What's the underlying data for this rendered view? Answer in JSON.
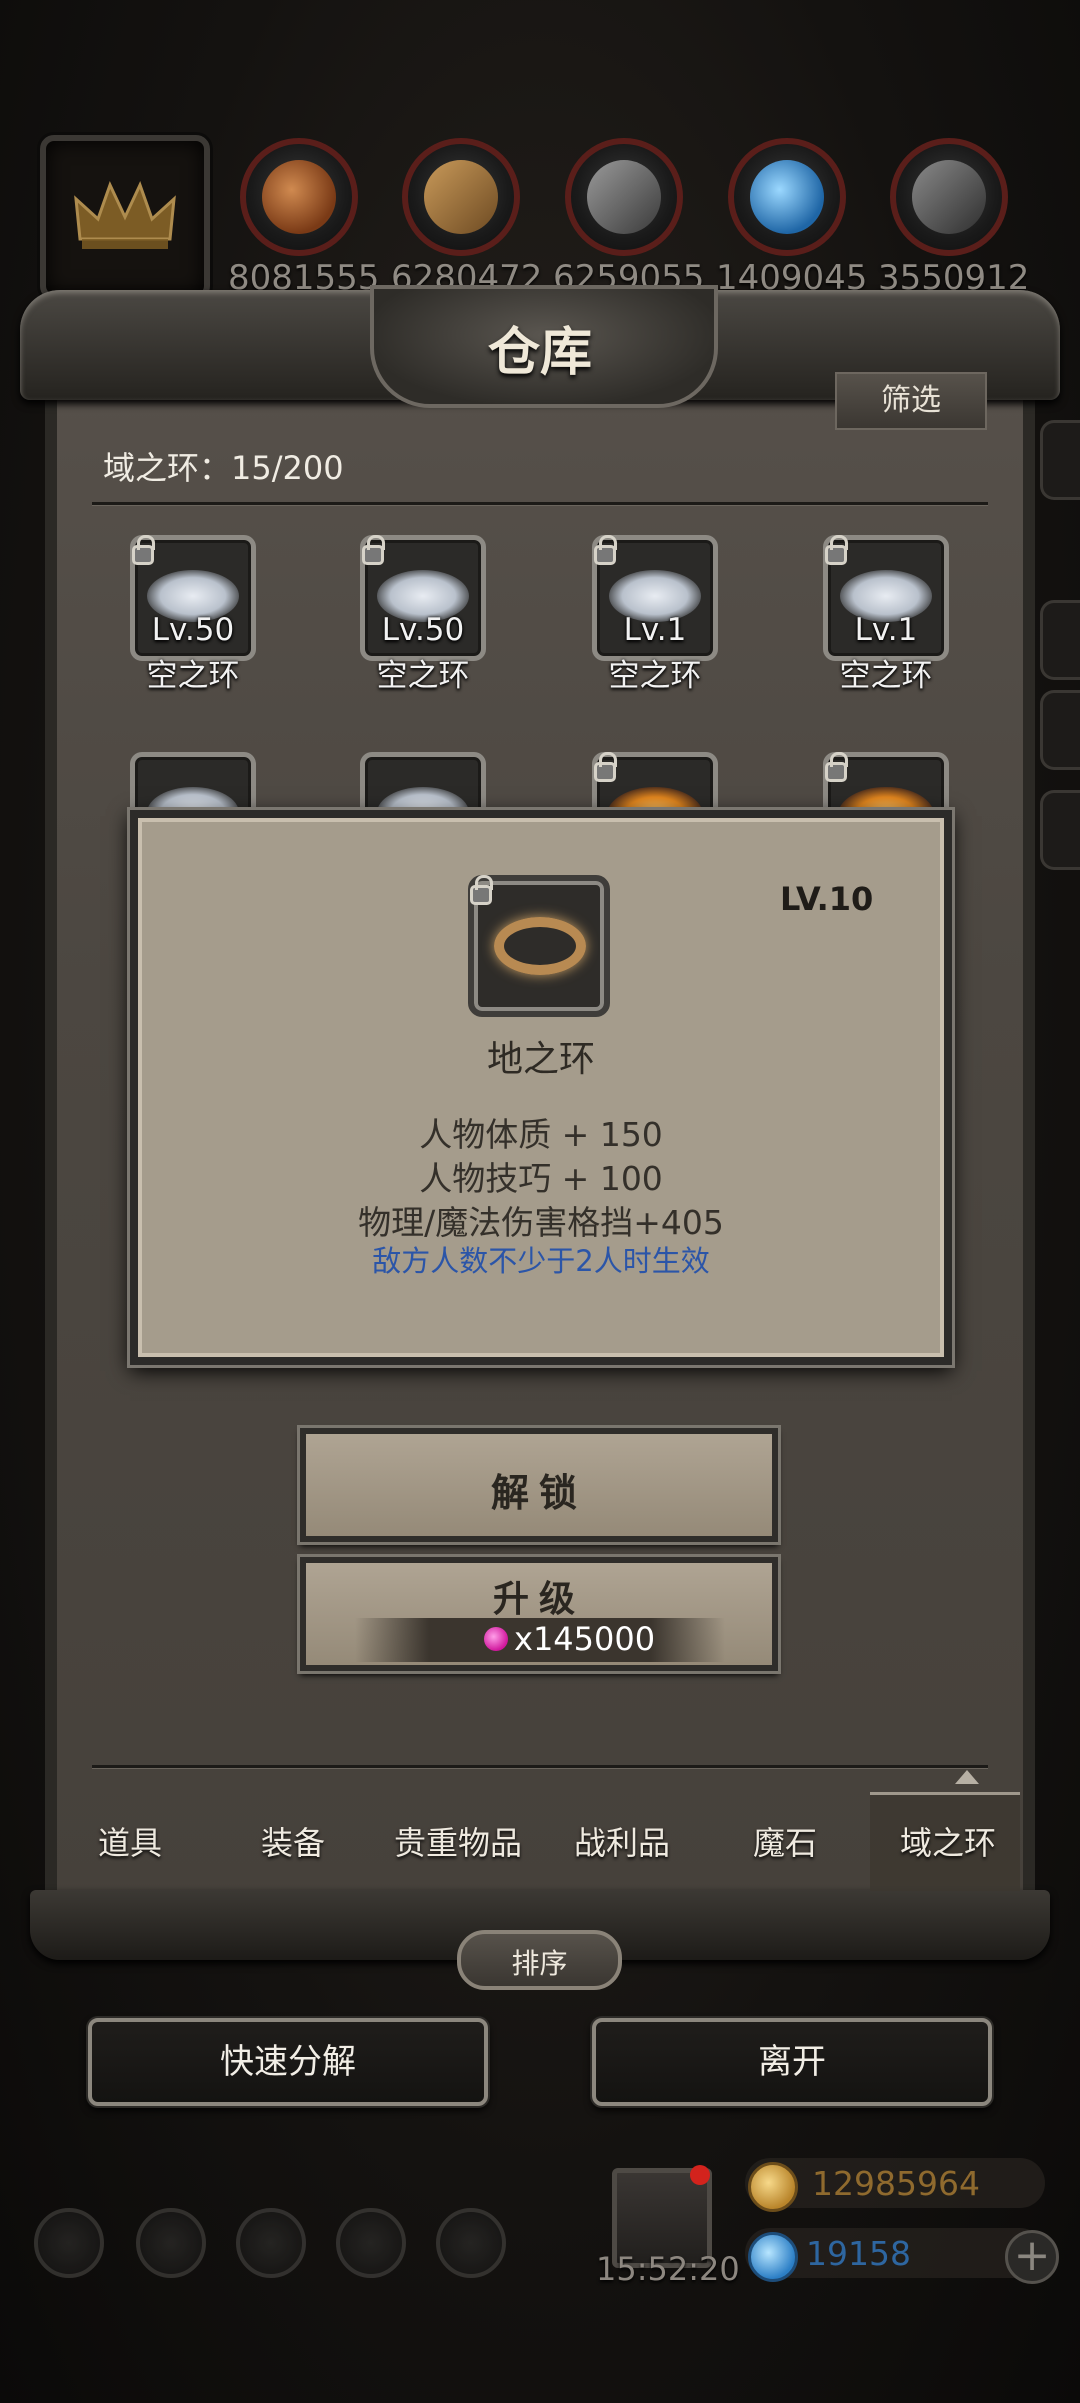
{
  "resources": [
    {
      "name": "crown-slot",
      "value": ""
    },
    {
      "name": "wood-logs",
      "value": "8081555",
      "color": "#b5652c"
    },
    {
      "name": "planks",
      "value": "6280472",
      "color": "#b98b4f"
    },
    {
      "name": "stone",
      "value": "6259055",
      "color": "#6e6e6e"
    },
    {
      "name": "crystal",
      "value": "1409045",
      "color": "#3fa0e6"
    },
    {
      "name": "iron",
      "value": "3550912",
      "color": "#7c7c7c"
    }
  ],
  "warehouse": {
    "title": "仓库",
    "filter_label": "筛选",
    "category_count": "域之环：15/200"
  },
  "items": [
    {
      "level": "Lv.50",
      "name": "空之环",
      "locked": true,
      "element": "sky"
    },
    {
      "level": "Lv.50",
      "name": "空之环",
      "locked": true,
      "element": "sky"
    },
    {
      "level": "Lv.1",
      "name": "空之环",
      "locked": true,
      "element": "sky"
    },
    {
      "level": "Lv.1",
      "name": "空之环",
      "locked": true,
      "element": "sky"
    }
  ],
  "popup": {
    "level": "LV.10",
    "name": "地之环",
    "stats": [
      "人物体质 + 150",
      "人物技巧 + 100",
      "物理/魔法伤害格挡+405"
    ],
    "condition": "敌方人数不少于2人时生效",
    "unlock_label": "解锁",
    "upgrade_label": "升级",
    "upgrade_cost": "x145000"
  },
  "tabs": [
    "道具",
    "装备",
    "贵重物品",
    "战利品",
    "魔石",
    "域之环"
  ],
  "active_tab": "域之环",
  "sort_label": "排序",
  "quick_decompose_label": "快速分解",
  "leave_label": "离开",
  "footer": {
    "timer": "15:52:20",
    "gold": "12985964",
    "diamonds": "19158"
  }
}
